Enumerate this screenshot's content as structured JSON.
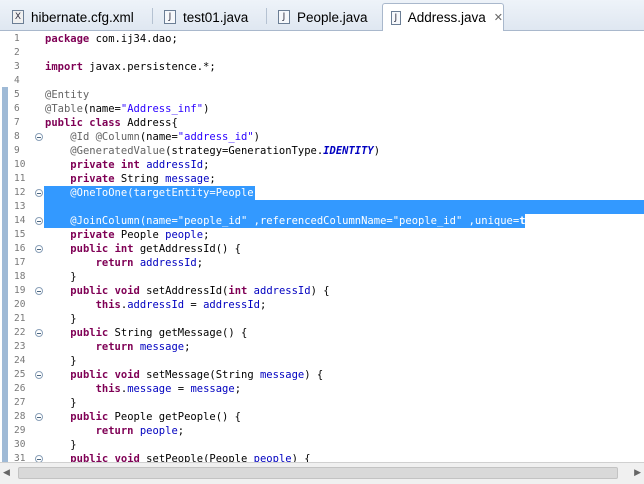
{
  "tabs": [
    {
      "label": "hibernate.cfg.xml",
      "icon": "xml-file-icon",
      "active": false
    },
    {
      "label": "test01.java",
      "icon": "java-file-icon",
      "active": false
    },
    {
      "label": "People.java",
      "icon": "java-file-icon",
      "active": false
    },
    {
      "label": "Address.java",
      "icon": "java-file-icon",
      "active": true,
      "close": "✕"
    }
  ],
  "editor": {
    "colors": {
      "selection": "#3399ff",
      "keyword": "#7f0055",
      "annotation": "#646464",
      "string": "#2a00ff",
      "field": "#0000c0"
    },
    "lines": [
      {
        "n": "1",
        "text": "package com.ij34.dao;"
      },
      {
        "n": "2",
        "text": ""
      },
      {
        "n": "3",
        "text": "import javax.persistence.*;"
      },
      {
        "n": "4",
        "text": ""
      },
      {
        "n": "5",
        "text": "@Entity"
      },
      {
        "n": "6",
        "text": "@Table(name=\"Address_inf\")"
      },
      {
        "n": "7",
        "text": "public class Address{"
      },
      {
        "n": "8",
        "text": "    @Id @Column(name=\"address_id\")",
        "fold": true
      },
      {
        "n": "9",
        "text": "    @GeneratedValue(strategy=GenerationType.IDENTITY)"
      },
      {
        "n": "10",
        "text": "    private int addressId;"
      },
      {
        "n": "11",
        "text": "    private String message;"
      },
      {
        "n": "12",
        "text": "    @OneToOne(targetEntity=People.class)",
        "fold": true,
        "selected": true
      },
      {
        "n": "13",
        "text": "",
        "selected": true
      },
      {
        "n": "14",
        "text": "    @JoinColumn(name=\"people_id\" ,referencedColumnName=\"people_id\" ,unique=true)",
        "fold": true,
        "selected": true
      },
      {
        "n": "15",
        "text": "    private People people;"
      },
      {
        "n": "16",
        "text": "    public int getAddressId() {",
        "fold": true
      },
      {
        "n": "17",
        "text": "        return addressId;"
      },
      {
        "n": "18",
        "text": "    }"
      },
      {
        "n": "19",
        "text": "    public void setAddressId(int addressId) {",
        "fold": true
      },
      {
        "n": "20",
        "text": "        this.addressId = addressId;"
      },
      {
        "n": "21",
        "text": "    }"
      },
      {
        "n": "22",
        "text": "    public String getMessage() {",
        "fold": true
      },
      {
        "n": "23",
        "text": "        return message;"
      },
      {
        "n": "24",
        "text": "    }"
      },
      {
        "n": "25",
        "text": "    public void setMessage(String message) {",
        "fold": true
      },
      {
        "n": "26",
        "text": "        this.message = message;"
      },
      {
        "n": "27",
        "text": "    }"
      },
      {
        "n": "28",
        "text": "    public People getPeople() {",
        "fold": true
      },
      {
        "n": "29",
        "text": "        return people;"
      },
      {
        "n": "30",
        "text": "    }"
      },
      {
        "n": "31",
        "text": "    public void setPeople(People people) {",
        "fold": true
      }
    ]
  }
}
